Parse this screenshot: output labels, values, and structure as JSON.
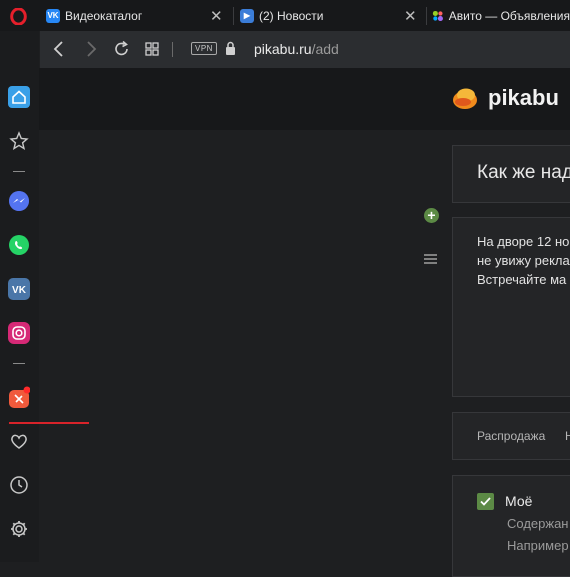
{
  "tabs": [
    {
      "label": "Видеокаталог",
      "favicon": "vk-icon",
      "color": "#2787f5"
    },
    {
      "label": "(2) Новости",
      "favicon": "news-icon",
      "color": "#3b7dd8"
    },
    {
      "label": "Авито — Объявления",
      "favicon": "avito-icon",
      "color": "#97cf26"
    }
  ],
  "address": {
    "host": "pikabu.ru",
    "path": "/add",
    "vpn_label": "VPN"
  },
  "site": {
    "brand": "pikabu"
  },
  "editor": {
    "title": "Как же над",
    "text_lines": [
      "На дворе 12 но",
      "не увижу рекла",
      "Встречайте ма"
    ],
    "tags": [
      "Распродажа",
      "Н"
    ],
    "own_label": "Моё",
    "own_sub": [
      "Содержан",
      "Например"
    ]
  },
  "colors": {
    "accent_green": "#5c8a45",
    "opera_red": "#d8232a"
  }
}
